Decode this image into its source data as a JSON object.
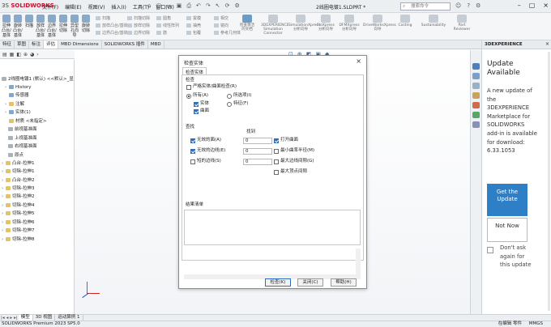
{
  "app": {
    "brand_prefix": "3S",
    "brand_name": "SOLIDWORKS",
    "menu": [
      "文件(F)",
      "编辑(E)",
      "视图(V)",
      "插入(I)",
      "工具(T)",
      "窗口(W)"
    ],
    "doc_title": "2线圈电镀1.SLDPRT *",
    "search_placeholder": "搜索命令"
  },
  "ribbon": {
    "big_buttons": [
      {
        "label": "拉伸凸台/基体"
      },
      {
        "label": "旋转凸台/基体"
      },
      {
        "label": "扫描"
      },
      {
        "label": "放样凸台/基体"
      },
      {
        "label": "边界凸台/基体"
      },
      {
        "label": "拉伸切除"
      },
      {
        "label": "异型孔向导"
      },
      {
        "label": "旋转切除"
      }
    ],
    "small_buttons": [
      "扫描",
      "放样凸台/基体",
      "边界凸台/基体",
      "扫描切除",
      "放样切除",
      "边界切除",
      "圆角",
      "线性阵列",
      "筋",
      "拔模",
      "抽壳",
      "包覆",
      "相交",
      "镜向",
      "参考几何体",
      "曲线",
      "Instant3D"
    ],
    "featured": [
      {
        "label": "检查激活的文档"
      },
      {
        "label": "3DEXPERIENCE Simulation Connector"
      },
      {
        "label": "SimulationXpress 分析向导"
      },
      {
        "label": "FloXpress 分析向导"
      },
      {
        "label": "DFMXpress 分析向导"
      },
      {
        "label": "DriveWorksXpress 向导"
      },
      {
        "label": "Costing"
      },
      {
        "label": "Sustainability"
      },
      {
        "label": "Part Reviewer"
      }
    ]
  },
  "tabs": [
    "特征",
    "草图",
    "标注",
    "评估",
    "MBD Dimensions",
    "SOLIDWORKS 插件",
    "MBD"
  ],
  "active_tab_index": 3,
  "tree": {
    "root": "2线圈电镀1 (默认) <<默认>_显",
    "items": [
      {
        "label": "History",
        "icon": "history-icon"
      },
      {
        "label": "传感器",
        "icon": "sensor-icon"
      },
      {
        "label": "注解",
        "icon": "annotation-icon"
      },
      {
        "label": "实体(1)",
        "icon": "solid-bodies-icon"
      },
      {
        "label": "材质 <未指定>",
        "icon": "material-icon"
      },
      {
        "label": "前视基准面",
        "icon": "plane-icon"
      },
      {
        "label": "上视基准面",
        "icon": "plane-icon"
      },
      {
        "label": "右视基准面",
        "icon": "plane-icon"
      },
      {
        "label": "原点",
        "icon": "origin-icon"
      },
      {
        "label": "凸台-拉伸1",
        "icon": "extrude-icon"
      },
      {
        "label": "切除-拉伸1",
        "icon": "cut-extrude-icon"
      },
      {
        "label": "凸台-拉伸2",
        "icon": "extrude-icon"
      },
      {
        "label": "切除-拉伸3",
        "icon": "cut-extrude-icon"
      },
      {
        "label": "切除-拉伸2",
        "icon": "cut-extrude-icon"
      },
      {
        "label": "切除-拉伸4",
        "icon": "cut-extrude-icon"
      },
      {
        "label": "切除-拉伸5",
        "icon": "cut-extrude-icon"
      },
      {
        "label": "切除-拉伸6",
        "icon": "cut-extrude-icon"
      },
      {
        "label": "切除-拉伸7",
        "icon": "cut-extrude-icon"
      },
      {
        "label": "切除-拉伸8",
        "icon": "cut-extrude-icon"
      }
    ]
  },
  "dialog": {
    "title": "检查实体",
    "tab": "检查实体",
    "check_section": "检查",
    "strict": {
      "label": "严格实体/曲面检查(R)",
      "checked": false
    },
    "scope": {
      "all": {
        "label": "所有(A)",
        "selected": true
      },
      "selected": {
        "label": "所选项(I)",
        "selected": false
      },
      "features": {
        "label": "特征(F)",
        "selected": false
      }
    },
    "entities": {
      "solid": {
        "label": "实体",
        "checked": true
      },
      "surface": {
        "label": "曲面",
        "checked": true
      }
    },
    "find_section": "查找",
    "found_header": "找到",
    "find_rows": [
      {
        "label": "无效的面(A)",
        "checked": true,
        "count": "0"
      },
      {
        "label": "无效的边线(E)",
        "checked": true,
        "count": "0"
      },
      {
        "label": "短的边线(S)",
        "checked": false,
        "count": "0"
      }
    ],
    "right_options": [
      {
        "label": "打开曲面",
        "checked": true
      },
      {
        "label": "最小曲率半径(M)",
        "checked": false
      },
      {
        "label": "最大边线间隙(G)",
        "checked": false
      },
      {
        "label": "最大顶点间隙",
        "checked": false
      }
    ],
    "result_label": "结果清单",
    "buttons": {
      "check": "检查(K)",
      "close": "关闭(C)",
      "help": "帮助(H)"
    }
  },
  "panel": {
    "brand": "3DEXPERIENCE",
    "title": "Update Available",
    "body": "A new update of the 3DEXPERIENCE Marketplace for SOLIDWORKS add-in is available for download: 6.33.1053",
    "get_label": "Get the Update",
    "not_now_label": "Not Now",
    "dont_ask": "Don't ask again for this update"
  },
  "bottom_tabs": [
    "模型",
    "3D 视图",
    "运动算例 1"
  ],
  "status": {
    "app_version": "SOLIDWORKS Premium 2023 SP5.0",
    "edit_state": "在编辑 零件",
    "units": "MMGS"
  },
  "colors": {
    "brand_red": "#c8102e",
    "accent_blue": "#2f7fc6",
    "checkbox_blue": "#2f6fbf"
  }
}
